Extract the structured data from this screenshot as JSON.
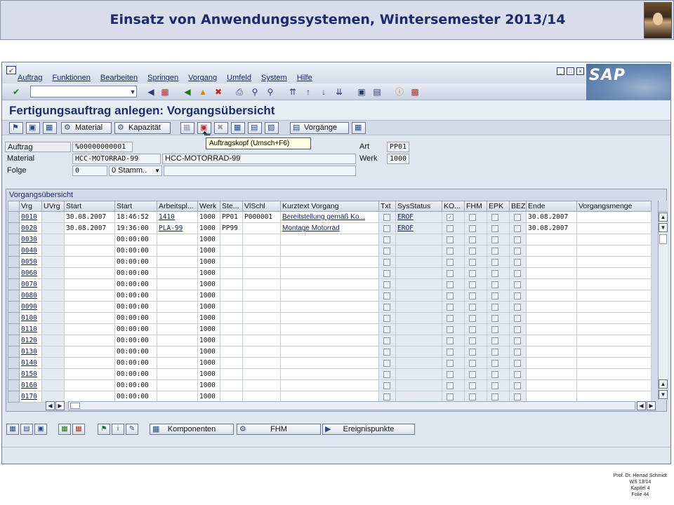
{
  "slide": {
    "title": "Einsatz von Anwendungssystemen, Wintersemester 2013/14",
    "footer": [
      "Prof. Dr. Herrad Schmidt",
      "WS 13/14",
      "Kapitel 4",
      "Folie 44"
    ]
  },
  "menubar": {
    "items": [
      "Auftrag",
      "Funktionen",
      "Bearbeiten",
      "Springen",
      "Vorgang",
      "Umfeld",
      "System",
      "Hilfe"
    ],
    "logo": "SAP"
  },
  "screen": {
    "title": "Fertigungsauftrag anlegen: Vorgangsübersicht"
  },
  "app_toolbar": {
    "material_label": "Material",
    "kapazitaet_label": "Kapazität",
    "vorgaenge_label": "Vorgänge"
  },
  "tooltip": "Auftragskopf  (Umsch+F6)",
  "header_fields": {
    "auftrag_label": "Auftrag",
    "auftrag_value": "%00000000001",
    "material_label": "Material",
    "material_value": "HCC-MOTORRAD-99",
    "material_desc": "HCC-MOTORRAD-99",
    "folge_label": "Folge",
    "folge_value": "0",
    "folge_select": "0 Stamm..",
    "art_label": "Art",
    "art_value": "PP01",
    "werk_label": "Werk",
    "werk_value": "1000"
  },
  "table": {
    "title": "Vorgangsübersicht",
    "columns": [
      "Vrg",
      "UVrg",
      "Start",
      "Start",
      "Arbeitspl...",
      "Werk",
      "Ste...",
      "VlSchl",
      "Kurztext Vorgang",
      "Txt",
      "SysStatus",
      "KO...",
      "FHM",
      "EPK",
      "BEZ",
      "Ende",
      "Vorgangsmenge"
    ],
    "rows": [
      {
        "vrg": "0010",
        "uvrg": "",
        "start_date": "30.08.2007",
        "start_time": "18:46:52",
        "arbpl": "1410",
        "werk": "1000",
        "ste": "PP01",
        "vlschl": "P000001",
        "kurztext": "Bereitstellung gemäß Ko...",
        "status": "EROF",
        "ko": true,
        "ende": "30.08.2007",
        "menge": ""
      },
      {
        "vrg": "0020",
        "uvrg": "",
        "start_date": "30.08.2007",
        "start_time": "19:36:00",
        "arbpl": "PLA-99",
        "werk": "1000",
        "ste": "PP99",
        "vlschl": "",
        "kurztext": "Montage Motorrad",
        "status": "EROF",
        "ko": false,
        "ende": "30.08.2007",
        "menge": ""
      },
      {
        "vrg": "0030",
        "uvrg": "",
        "start_date": "",
        "start_time": "00:00:00",
        "arbpl": "",
        "werk": "1000",
        "ste": "",
        "vlschl": "",
        "kurztext": "",
        "status": "",
        "ko": false,
        "ende": "",
        "menge": ""
      },
      {
        "vrg": "0040",
        "uvrg": "",
        "start_date": "",
        "start_time": "00:00:00",
        "arbpl": "",
        "werk": "1000",
        "ste": "",
        "vlschl": "",
        "kurztext": "",
        "status": "",
        "ko": false,
        "ende": "",
        "menge": ""
      },
      {
        "vrg": "0050",
        "uvrg": "",
        "start_date": "",
        "start_time": "00:00:00",
        "arbpl": "",
        "werk": "1000",
        "ste": "",
        "vlschl": "",
        "kurztext": "",
        "status": "",
        "ko": false,
        "ende": "",
        "menge": ""
      },
      {
        "vrg": "0060",
        "uvrg": "",
        "start_date": "",
        "start_time": "00:00:00",
        "arbpl": "",
        "werk": "1000",
        "ste": "",
        "vlschl": "",
        "kurztext": "",
        "status": "",
        "ko": false,
        "ende": "",
        "menge": ""
      },
      {
        "vrg": "0070",
        "uvrg": "",
        "start_date": "",
        "start_time": "00:00:00",
        "arbpl": "",
        "werk": "1000",
        "ste": "",
        "vlschl": "",
        "kurztext": "",
        "status": "",
        "ko": false,
        "ende": "",
        "menge": ""
      },
      {
        "vrg": "0080",
        "uvrg": "",
        "start_date": "",
        "start_time": "00:00:00",
        "arbpl": "",
        "werk": "1000",
        "ste": "",
        "vlschl": "",
        "kurztext": "",
        "status": "",
        "ko": false,
        "ende": "",
        "menge": ""
      },
      {
        "vrg": "0090",
        "uvrg": "",
        "start_date": "",
        "start_time": "00:00:00",
        "arbpl": "",
        "werk": "1000",
        "ste": "",
        "vlschl": "",
        "kurztext": "",
        "status": "",
        "ko": false,
        "ende": "",
        "menge": ""
      },
      {
        "vrg": "0100",
        "uvrg": "",
        "start_date": "",
        "start_time": "00:00:00",
        "arbpl": "",
        "werk": "1000",
        "ste": "",
        "vlschl": "",
        "kurztext": "",
        "status": "",
        "ko": false,
        "ende": "",
        "menge": ""
      },
      {
        "vrg": "0110",
        "uvrg": "",
        "start_date": "",
        "start_time": "00:00:00",
        "arbpl": "",
        "werk": "1000",
        "ste": "",
        "vlschl": "",
        "kurztext": "",
        "status": "",
        "ko": false,
        "ende": "",
        "menge": ""
      },
      {
        "vrg": "0120",
        "uvrg": "",
        "start_date": "",
        "start_time": "00:00:00",
        "arbpl": "",
        "werk": "1000",
        "ste": "",
        "vlschl": "",
        "kurztext": "",
        "status": "",
        "ko": false,
        "ende": "",
        "menge": ""
      },
      {
        "vrg": "0130",
        "uvrg": "",
        "start_date": "",
        "start_time": "00:00:00",
        "arbpl": "",
        "werk": "1000",
        "ste": "",
        "vlschl": "",
        "kurztext": "",
        "status": "",
        "ko": false,
        "ende": "",
        "menge": ""
      },
      {
        "vrg": "0140",
        "uvrg": "",
        "start_date": "",
        "start_time": "00:00:00",
        "arbpl": "",
        "werk": "1000",
        "ste": "",
        "vlschl": "",
        "kurztext": "",
        "status": "",
        "ko": false,
        "ende": "",
        "menge": ""
      },
      {
        "vrg": "0150",
        "uvrg": "",
        "start_date": "",
        "start_time": "00:00:00",
        "arbpl": "",
        "werk": "1000",
        "ste": "",
        "vlschl": "",
        "kurztext": "",
        "status": "",
        "ko": false,
        "ende": "",
        "menge": ""
      },
      {
        "vrg": "0160",
        "uvrg": "",
        "start_date": "",
        "start_time": "00:00:00",
        "arbpl": "",
        "werk": "1000",
        "ste": "",
        "vlschl": "",
        "kurztext": "",
        "status": "",
        "ko": false,
        "ende": "",
        "menge": ""
      },
      {
        "vrg": "0170",
        "uvrg": "",
        "start_date": "",
        "start_time": "00:00:00",
        "arbpl": "",
        "werk": "1000",
        "ste": "",
        "vlschl": "",
        "kurztext": "",
        "status": "",
        "ko": false,
        "ende": "",
        "menge": ""
      }
    ]
  },
  "bottom_toolbar": {
    "komponenten_label": "Komponenten",
    "fhm_label": "FHM",
    "ereignispunkte_label": "Ereignispunkte"
  },
  "colors": {
    "header_bg": "#d9dde9",
    "title_color": "#1d2a6b",
    "window_bg": "#dfe6f0"
  }
}
